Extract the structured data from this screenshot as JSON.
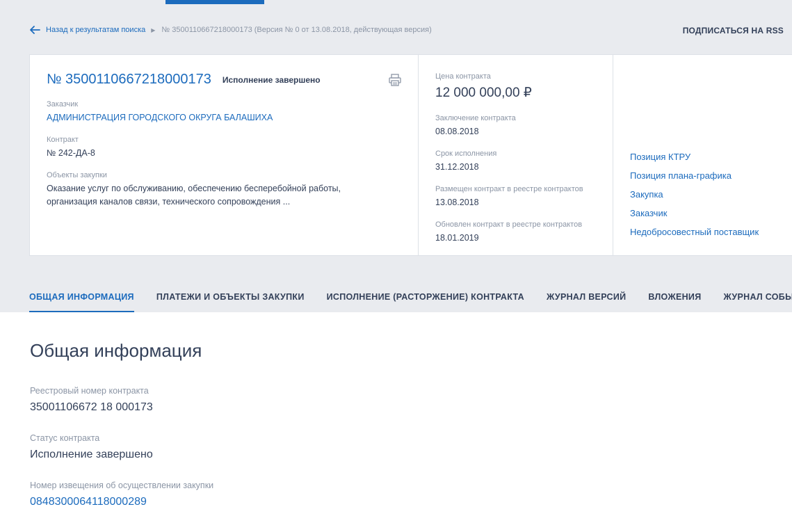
{
  "breadcrumb": {
    "back_label": "Назад к результатам поиска",
    "current": "№ 3500110667218000173 (Версия № 0 от 13.08.2018, действующая версия)"
  },
  "header": {
    "rss_label": "ПОДПИСАТЬСЯ НА RSS"
  },
  "contract": {
    "reg_number": "№ 3500110667218000173",
    "status": "Исполнение завершено",
    "customer_label": "Заказчик",
    "customer": "АДМИНИСТРАЦИЯ ГОРОДСКОГО ОКРУГА БАЛАШИХА",
    "contract_label": "Контракт",
    "contract_number": "№ 242-ДА-8",
    "objects_label": "Объекты закупки",
    "objects_line1": "Оказание услуг по обслуживанию, обеспечению бесперебойной работы,",
    "objects_line2": "организация каналов связи, технического сопровождения ..."
  },
  "details": {
    "price_label": "Цена контракта",
    "price": "12 000 000,00 ₽",
    "conclusion_label": "Заключение контракта",
    "conclusion_date": "08.08.2018",
    "term_label": "Срок исполнения",
    "term_date": "31.12.2018",
    "placed_label": "Размещен контракт в реестре контрактов",
    "placed_date": "13.08.2018",
    "updated_label": "Обновлен контракт в реестре контрактов",
    "updated_date": "18.01.2019"
  },
  "side_links": [
    "Позиция КТРУ",
    "Позиция плана-графика",
    "Закупка",
    "Заказчик",
    "Недобросовестный поставщик"
  ],
  "tabs": [
    "ОБЩАЯ ИНФОРМАЦИЯ",
    "ПЛАТЕЖИ И ОБЪЕКТЫ ЗАКУПКИ",
    "ИСПОЛНЕНИЕ (РАСТОРЖЕНИЕ) КОНТРАКТА",
    "ЖУРНАЛ ВЕРСИЙ",
    "ВЛОЖЕНИЯ",
    "ЖУРНАЛ СОБЫТИЙ"
  ],
  "general": {
    "title": "Общая информация",
    "reg_label": "Реестровый номер контракта",
    "reg_value": "35001106672 18 000173",
    "status_label": "Статус контракта",
    "status_value": "Исполнение завершено",
    "notice_label": "Номер извещения об осуществлении закупки",
    "notice_value": "0848300064118000289"
  },
  "colors": {
    "accent": "#1c6bbd",
    "text": "#334059",
    "muted": "#8b95a5",
    "gray_bg": "#e9ebef"
  }
}
